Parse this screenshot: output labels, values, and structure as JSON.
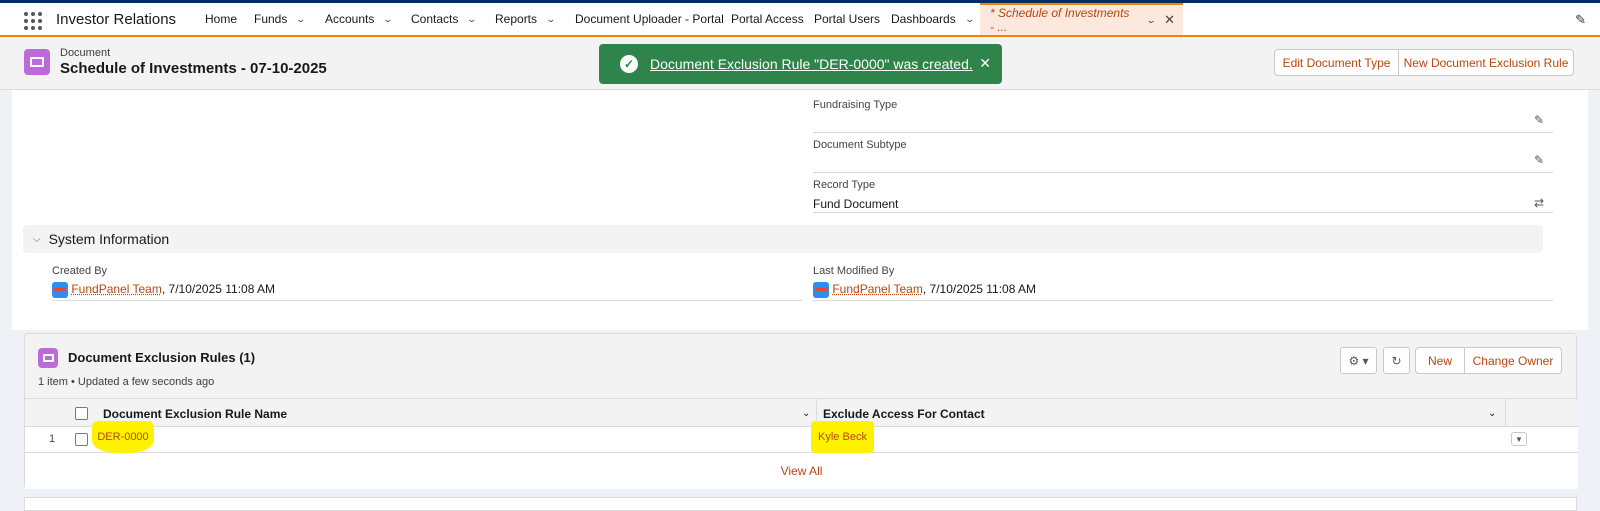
{
  "nav": {
    "app_name": "Investor Relations",
    "items": [
      {
        "label": "Home"
      },
      {
        "label": "Funds"
      },
      {
        "label": "Accounts"
      },
      {
        "label": "Contacts"
      },
      {
        "label": "Reports"
      },
      {
        "label": "Document Uploader - Portal"
      },
      {
        "label": "Portal Access"
      },
      {
        "label": "Portal Users"
      },
      {
        "label": "Dashboards"
      }
    ],
    "active_tab": "* Schedule of Investments - ..."
  },
  "header": {
    "object_type": "Document",
    "title": "Schedule of Investments - 07-10-2025",
    "buttons": {
      "edit_document_type": "Edit Document Type",
      "new_exclusion_rule": "New Document Exclusion Rule"
    }
  },
  "toast": {
    "message": "Document Exclusion Rule \"DER-0000\" was created."
  },
  "details": {
    "fundraising_type": {
      "label": "Fundraising Type",
      "value": ""
    },
    "document_subtype": {
      "label": "Document Subtype",
      "value": ""
    },
    "record_type": {
      "label": "Record Type",
      "value": "Fund Document"
    }
  },
  "system_info": {
    "title": "System Information",
    "created_by": {
      "label": "Created By",
      "user": "FundPanel Team",
      "date": ", 7/10/2025 11:08 AM"
    },
    "last_modified_by": {
      "label": "Last Modified By",
      "user": "FundPanel Team",
      "date": ", 7/10/2025 11:08 AM"
    }
  },
  "related_list": {
    "title": "Document Exclusion Rules (1)",
    "subtitle": "1 item • Updated a few seconds ago",
    "buttons": {
      "new": "New",
      "change_owner": "Change Owner"
    },
    "columns": [
      "Document Exclusion Rule Name",
      "Exclude Access For Contact"
    ],
    "rows": [
      {
        "num": "1",
        "name": "DER-0000",
        "contact": "Kyle Beck"
      }
    ],
    "view_all": "View All"
  }
}
